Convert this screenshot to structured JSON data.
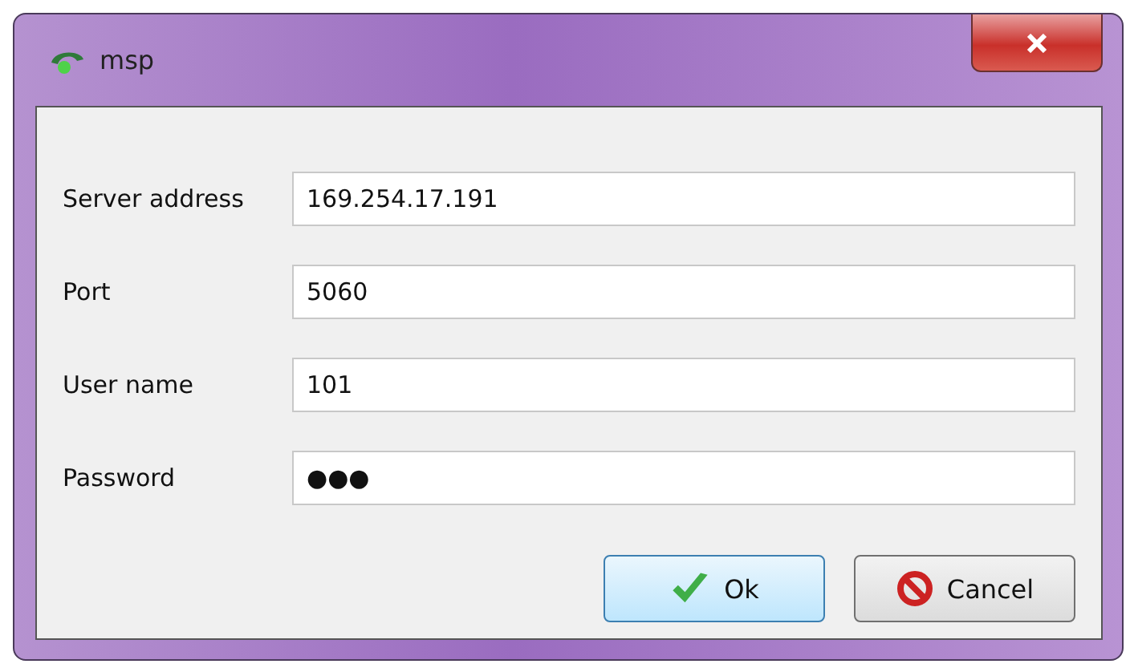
{
  "window": {
    "title": "msp"
  },
  "fields": [
    {
      "label": "Server address",
      "value": "169.254.17.191"
    },
    {
      "label": "Port",
      "value": "5060"
    },
    {
      "label": "User name",
      "value": "101"
    },
    {
      "label": "Password",
      "value": "●●●"
    }
  ],
  "buttons": [
    {
      "label": "Ok",
      "kind": "ok",
      "default": true
    },
    {
      "label": "Cancel",
      "kind": "cancel",
      "default": false
    }
  ]
}
